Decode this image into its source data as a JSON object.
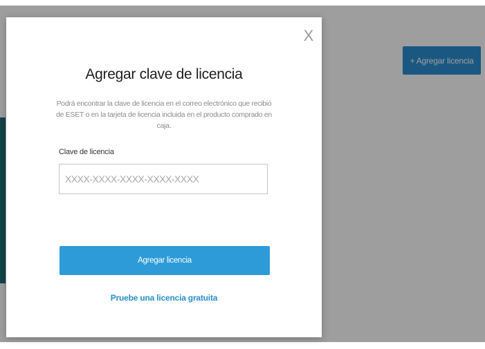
{
  "background": {
    "add_license_button_label": "+ Agregar licencia"
  },
  "modal": {
    "close_glyph": "X",
    "title": "Agregar clave de licencia",
    "description": "Podrá encontrar la clave de licencia en el correo electrónico que recibió de ESET o en la tarjeta de licencia incluida en el producto comprado en caja.",
    "field_label": "Clave de licencia",
    "input_value": "",
    "input_placeholder": "XXXX-XXXX-XXXX-XXXX-XXXX",
    "submit_label": "Agregar licencia",
    "trial_link_label": "Pruebe una licencia gratuita"
  },
  "colors": {
    "primary": "#2d9bd8",
    "link": "#2a8fc7",
    "overlay": "rgba(0,0,0,0.38)"
  }
}
